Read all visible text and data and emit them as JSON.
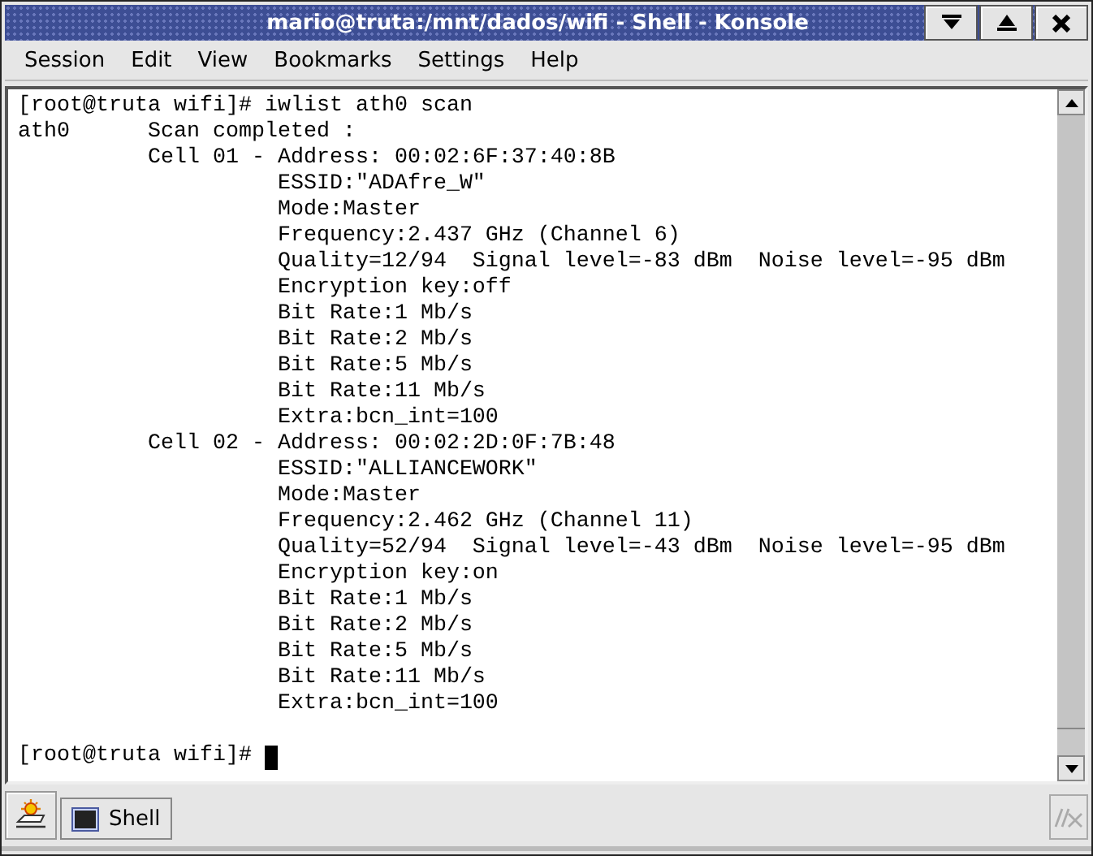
{
  "window": {
    "title": "mario@truta:/mnt/dados/wifi - Shell - Konsole"
  },
  "menu": [
    "Session",
    "Edit",
    "View",
    "Bookmarks",
    "Settings",
    "Help"
  ],
  "terminal": {
    "cursor": true,
    "lines": [
      {
        "kind": "text",
        "text": "[root@truta wifi]# iwlist ath0 scan"
      },
      {
        "kind": "text",
        "text": "ath0      Scan completed :"
      },
      {
        "kind": "text",
        "text": "          Cell 01 - Address: 00:02:6F:37:40:8B"
      },
      {
        "kind": "text",
        "text": "                    ESSID:\"ADAfre_W\""
      },
      {
        "kind": "text",
        "text": "                    Mode:Master"
      },
      {
        "kind": "text",
        "text": "                    Frequency:2.437 GHz (Channel 6)"
      },
      {
        "kind": "text",
        "text": "                    Quality=12/94  Signal level=-83 dBm  Noise level=-95 dBm"
      },
      {
        "kind": "text",
        "text": "                    Encryption key:off"
      },
      {
        "kind": "text",
        "text": "                    Bit Rate:1 Mb/s"
      },
      {
        "kind": "text",
        "text": "                    Bit Rate:2 Mb/s"
      },
      {
        "kind": "text",
        "text": "                    Bit Rate:5 Mb/s"
      },
      {
        "kind": "text",
        "text": "                    Bit Rate:11 Mb/s"
      },
      {
        "kind": "text",
        "text": "                    Extra:bcn_int=100"
      },
      {
        "kind": "text",
        "text": "          Cell 02 - Address: 00:02:2D:0F:7B:48"
      },
      {
        "kind": "text",
        "text": "                    ESSID:\"ALLIANCEWORK\""
      },
      {
        "kind": "text",
        "text": "                    Mode:Master"
      },
      {
        "kind": "text",
        "text": "                    Frequency:2.462 GHz (Channel 11)"
      },
      {
        "kind": "text",
        "text": "                    Quality=52/94  Signal level=-43 dBm  Noise level=-95 dBm"
      },
      {
        "kind": "text",
        "text": "                    Encryption key:on"
      },
      {
        "kind": "text",
        "text": "                    Bit Rate:1 Mb/s"
      },
      {
        "kind": "text",
        "text": "                    Bit Rate:2 Mb/s"
      },
      {
        "kind": "text",
        "text": "                    Bit Rate:5 Mb/s"
      },
      {
        "kind": "text",
        "text": "                    Bit Rate:11 Mb/s"
      },
      {
        "kind": "text",
        "text": "                    Extra:bcn_int=100"
      },
      {
        "kind": "blank"
      },
      {
        "kind": "prompt",
        "text": "[root@truta wifi]# "
      }
    ]
  },
  "session_tabs": [
    {
      "label": "Shell",
      "selected": true
    }
  ],
  "close_session": {
    "disabled": true
  }
}
